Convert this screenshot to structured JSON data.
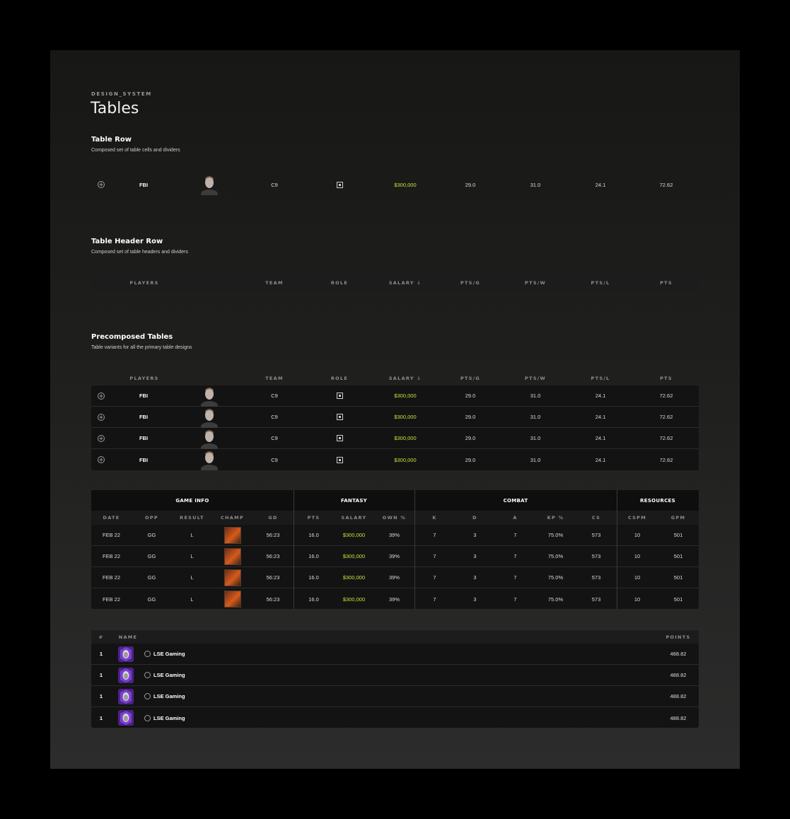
{
  "page": {
    "eyebrow": "DESIGN_SYSTEM",
    "title": "Tables"
  },
  "sections": {
    "table_row": {
      "title": "Table Row",
      "desc": "Composed set of table cells and dividers"
    },
    "table_header_row": {
      "title": "Table Header Row",
      "desc": "Composed set of table headers and dividers"
    },
    "precomposed": {
      "title": "Precomposed Tables",
      "desc": "Table variants for all the primary table designs"
    }
  },
  "player_headers": {
    "players": "PLAYERS",
    "team": "TEAM",
    "role": "ROLE",
    "salary": "SALARY ↓",
    "ptsg": "PTS/G",
    "ptsw": "PTS/W",
    "ptsl": "PTS/L",
    "pts": "PTS"
  },
  "player_row": {
    "name": "FBI",
    "team": "C9",
    "salary": "$300,000",
    "ptsg": "29.0",
    "ptsw": "31.0",
    "ptsl": "24.1",
    "pts": "72.62"
  },
  "player_rows": [
    {
      "name": "FBI",
      "team": "C9",
      "salary": "$300,000",
      "ptsg": "29.0",
      "ptsw": "31.0",
      "ptsl": "24.1",
      "pts": "72.62"
    },
    {
      "name": "FBI",
      "team": "C9",
      "salary": "$300,000",
      "ptsg": "29.0",
      "ptsw": "31.0",
      "ptsl": "24.1",
      "pts": "72.62"
    },
    {
      "name": "FBI",
      "team": "C9",
      "salary": "$300,000",
      "ptsg": "29.0",
      "ptsw": "31.0",
      "ptsl": "24.1",
      "pts": "72.62"
    },
    {
      "name": "FBI",
      "team": "C9",
      "salary": "$300,000",
      "ptsg": "29.0",
      "ptsw": "31.0",
      "ptsl": "24.1",
      "pts": "72.62"
    }
  ],
  "game_table": {
    "groups": [
      "GAME INFO",
      "FANTASY",
      "COMBAT",
      "RESOURCES"
    ],
    "headers": [
      "DATE",
      "OPP",
      "RESULT",
      "CHAMP",
      "GD",
      "PTS",
      "SALARY",
      "OWN %",
      "K",
      "D",
      "A",
      "KP %",
      "CS",
      "CSPM",
      "GPM"
    ],
    "rows": [
      {
        "date": "FEB 22",
        "opp": "GG",
        "result": "L",
        "gd": "56:23",
        "pts": "16.0",
        "salary": "$300,000",
        "own": "39%",
        "k": "7",
        "d": "3",
        "a": "7",
        "kp": "75.0%",
        "cs": "573",
        "cspm": "10",
        "gpm": "501"
      },
      {
        "date": "FEB 22",
        "opp": "GG",
        "result": "L",
        "gd": "56:23",
        "pts": "16.0",
        "salary": "$300,000",
        "own": "39%",
        "k": "7",
        "d": "3",
        "a": "7",
        "kp": "75.0%",
        "cs": "573",
        "cspm": "10",
        "gpm": "501"
      },
      {
        "date": "FEB 22",
        "opp": "GG",
        "result": "L",
        "gd": "56:23",
        "pts": "16.0",
        "salary": "$300,000",
        "own": "39%",
        "k": "7",
        "d": "3",
        "a": "7",
        "kp": "75.0%",
        "cs": "573",
        "cspm": "10",
        "gpm": "501"
      },
      {
        "date": "FEB 22",
        "opp": "GG",
        "result": "L",
        "gd": "56:23",
        "pts": "16.0",
        "salary": "$300,000",
        "own": "39%",
        "k": "7",
        "d": "3",
        "a": "7",
        "kp": "75.0%",
        "cs": "573",
        "cspm": "10",
        "gpm": "501"
      }
    ]
  },
  "leaderboard": {
    "headers": {
      "rank": "#",
      "name": "NAME",
      "points": "POINTS"
    },
    "rows": [
      {
        "rank": "1",
        "name": "LSE Gaming",
        "points": "488.82"
      },
      {
        "rank": "1",
        "name": "LSE Gaming",
        "points": "488.82"
      },
      {
        "rank": "1",
        "name": "LSE Gaming",
        "points": "488.82"
      },
      {
        "rank": "1",
        "name": "LSE Gaming",
        "points": "488.82"
      }
    ]
  },
  "colors": {
    "accent_green": "#c6e23c",
    "row_bg": "#131313",
    "canvas": "#1a1a19",
    "purple_logo": "#7b3fd1"
  },
  "icons": {
    "add": "add-circle-icon",
    "role": "role-icon",
    "player": "player-avatar",
    "champ": "champion-portrait",
    "team": "team-logo",
    "badge": "rank-badge-icon"
  }
}
